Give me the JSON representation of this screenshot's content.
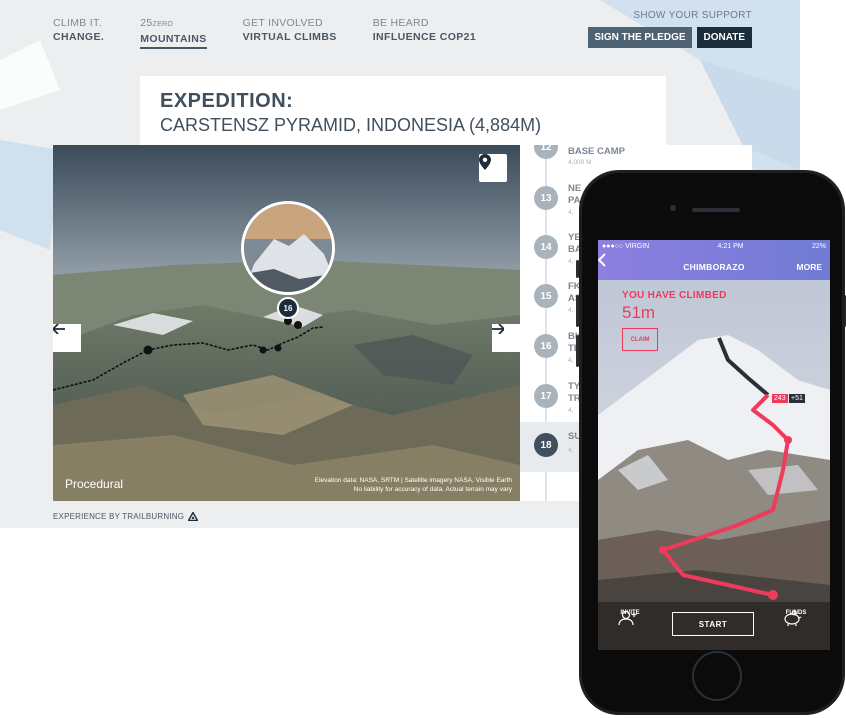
{
  "nav": {
    "items": [
      {
        "top": "CLIMB IT.",
        "bottom": "CHANGE.",
        "sup": ""
      },
      {
        "top": "25",
        "sup": "ZERO",
        "bottom": "MOUNTAINS"
      },
      {
        "top": "GET INVOLVED",
        "bottom": "VIRTUAL CLIMBS",
        "sup": ""
      },
      {
        "top": "BE HEARD",
        "bottom": "INFLUENCE COP21",
        "sup": ""
      }
    ],
    "active_index": 1
  },
  "support": {
    "label": "SHOW YOUR SUPPORT",
    "pledge_label": "SIGN THE PLEDGE",
    "donate_label": "DONATE"
  },
  "expedition": {
    "label": "EXPEDITION:",
    "name": "CARSTENSZ PYRAMID, INDONESIA (4,884M)"
  },
  "map": {
    "marker_number": "16",
    "procedural_label": "Procedural",
    "credit_line1": "Elevation data: NASA, SRTM | Satellite imagery NASA, Visible Earth",
    "credit_line2": "No liability for accuracy of data. Actual terrain may vary",
    "icons": {
      "pin": "map-pin-icon",
      "prev": "arrow-left-icon",
      "next": "arrow-right-icon"
    }
  },
  "steps": [
    {
      "num": "12",
      "title": "BASE CAMP",
      "sub": "4,000 M"
    },
    {
      "num": "13",
      "title": "NE",
      "sub2": "PA",
      "sub": "4,"
    },
    {
      "num": "14",
      "title": "YE",
      "sub2": "BA",
      "sub": "4,"
    },
    {
      "num": "15",
      "title": "FK",
      "sub2": "AS",
      "sub": "4,"
    },
    {
      "num": "16",
      "title": "BK",
      "sub2": "TE",
      "sub": "4,"
    },
    {
      "num": "17",
      "title": "TY",
      "sub2": "TR",
      "sub": "4,"
    },
    {
      "num": "18",
      "title": "SU",
      "sub2": "",
      "sub": "4,"
    }
  ],
  "active_step": "18",
  "trailburning": {
    "label": "EXPERIENCE BY TRAILBURNING",
    "icon": "trailburning-logo-icon"
  },
  "phone": {
    "status": {
      "carrier": "●●●○○ VIRGIN",
      "time": "4:21 PM",
      "battery": "22%"
    },
    "appbar": {
      "title": "CHIMBORAZO",
      "more": "MORE"
    },
    "climbed_label": "YOU HAVE CLIMBED",
    "climbed_value": "51m",
    "claim_label": "CLAIM",
    "badge_red": "243",
    "badge_dark": "+51",
    "invite_label": "INVITE",
    "start_label": "START",
    "funds_label": "FUNDS"
  },
  "colors": {
    "accent_pink": "#ee3b5b",
    "app_header_purple": "#7a7bd6",
    "nav_text": "#4a5866",
    "donate_bg": "#1b2c3a"
  }
}
